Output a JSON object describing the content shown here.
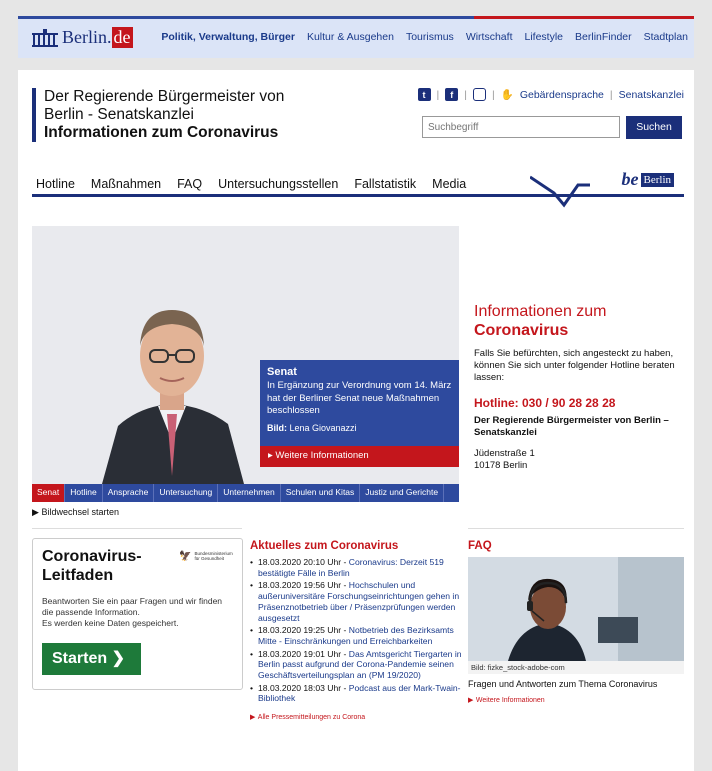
{
  "topnav": {
    "logo_brand": "Berlin.",
    "logo_tld": "de",
    "links": [
      "Politik, Verwaltung, Bürger",
      "Kultur & Ausgehen",
      "Tourismus",
      "Wirtschaft",
      "Lifestyle",
      "BerlinFinder",
      "Stadtplan"
    ]
  },
  "header": {
    "line1": "Der Regierende Bürgermeister von",
    "line2": "Berlin - Senatskanzlei",
    "line3": "Informationen zum Coronavirus",
    "social_icons": [
      "twitter-icon",
      "facebook-icon",
      "instagram-icon"
    ],
    "sign_language_label": "Gebärdensprache",
    "senatskanzlei_label": "Senatskanzlei",
    "search_placeholder": "Suchbegriff",
    "search_button": "Suchen"
  },
  "mainnav": {
    "items": [
      "Hotline",
      "Maßnahmen",
      "FAQ",
      "Untersuchungsstellen",
      "Fallstatistik",
      "Media"
    ],
    "be_logo": "be",
    "berlin_logo": "Berlin"
  },
  "hero": {
    "caption_title": "Senat",
    "caption_body": "In Ergänzung zur Verordnung vom 14. März hat der Berliner Senat neue Maßnahmen beschlossen",
    "caption_credit_label": "Bild:",
    "caption_credit": "Lena Giovanazzi",
    "caption_link": "Weitere Informationen",
    "tabs": [
      "Senat",
      "Hotline",
      "Ansprache",
      "Untersuchung",
      "Unternehmen",
      "Schulen und Kitas",
      "Justiz und Gerichte"
    ],
    "slideshow_label": "Bildwechsel starten"
  },
  "info": {
    "title1": "Informationen zum",
    "title2": "Coronavirus",
    "text": "Falls Sie befürchten, sich angesteckt zu haben, können Sie sich unter folgender Hotline beraten lassen:",
    "hotline": "Hotline: 030 / 90 28 28 28",
    "org": "Der Regierende Bürgermeister von Berlin – Senatskanzlei",
    "street": "Jüdenstraße 1",
    "city": "10178 Berlin"
  },
  "leitfaden": {
    "title_line1": "Coronavirus-",
    "title_line2": "Leitfaden",
    "ministry_line1": "Bundesministerium",
    "ministry_line2": "für Gesundheit",
    "desc_line1": "Beantworten Sie ein paar Fragen und wir finden die passende Information.",
    "desc_line2": "Es werden keine Daten gespeichert.",
    "button": "Starten ❯"
  },
  "aktuelles": {
    "heading": "Aktuelles zum Coronavirus",
    "items": [
      {
        "date": "18.03.2020 20:10 Uhr - ",
        "link": "Coronavirus: Derzeit 519 bestätigte Fälle in Berlin"
      },
      {
        "date": "18.03.2020 19:56 Uhr - ",
        "link": "Hochschulen und außeruniversitäre Forschungseinrichtungen gehen in Präsenznotbetrieb über / Präsenzprüfungen werden ausgesetzt"
      },
      {
        "date": "18.03.2020 19:25 Uhr - ",
        "link": "Notbetrieb des Bezirksamts Mitte - Einschränkungen und Erreichbarkeiten"
      },
      {
        "date": "18.03.2020 19:01 Uhr - ",
        "link": "Das Amtsgericht Tiergarten in Berlin passt aufgrund der Corona-Pandemie seinen Geschäftsverteilungsplan an (PM 19/2020)"
      },
      {
        "date": "18.03.2020 18:03 Uhr - ",
        "link": "Podcast aus der Mark-Twain-Bibliothek"
      }
    ],
    "all_link": "Alle Pressemitteilungen zu Corona"
  },
  "faq": {
    "heading": "FAQ",
    "image_credit": "Bild: fizke_stock-adobe-com",
    "text": "Fragen und Antworten zum Thema Coronavirus",
    "more_link": "Weitere Informationen"
  }
}
